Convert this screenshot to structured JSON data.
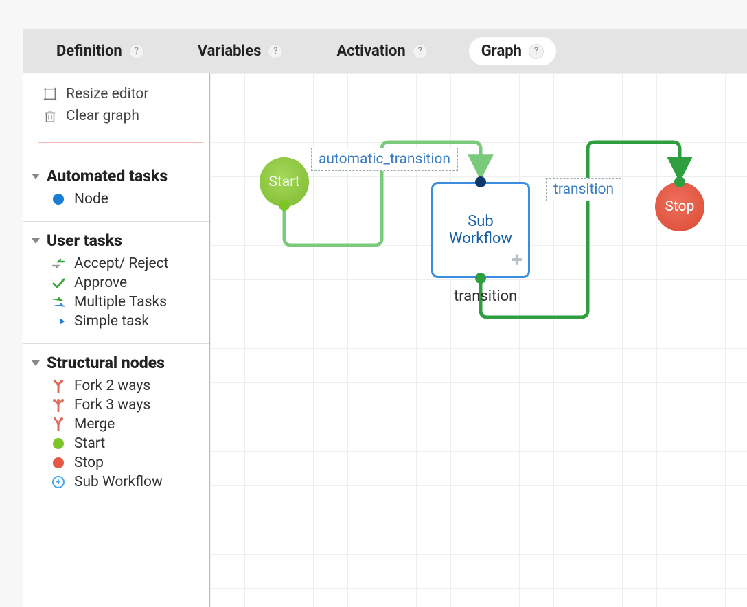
{
  "tabs": [
    {
      "label": "Definition",
      "active": false
    },
    {
      "label": "Variables",
      "active": false
    },
    {
      "label": "Activation",
      "active": false
    },
    {
      "label": "Graph",
      "active": true
    }
  ],
  "sidebar": {
    "actions": {
      "resize": "Resize editor",
      "clear": "Clear graph"
    },
    "groups": [
      {
        "title": "Automated tasks",
        "name": "automated-tasks",
        "items": [
          {
            "icon": "node",
            "label": "Node",
            "name": "node"
          }
        ]
      },
      {
        "title": "User tasks",
        "name": "user-tasks",
        "items": [
          {
            "icon": "accept-reject",
            "label": "Accept/ Reject",
            "name": "accept-reject"
          },
          {
            "icon": "approve",
            "label": "Approve",
            "name": "approve"
          },
          {
            "icon": "multiple",
            "label": "Multiple Tasks",
            "name": "multiple-tasks"
          },
          {
            "icon": "simple",
            "label": "Simple task",
            "name": "simple-task"
          }
        ]
      },
      {
        "title": "Structural nodes",
        "name": "structural-nodes",
        "items": [
          {
            "icon": "fork2",
            "label": "Fork 2 ways",
            "name": "fork-2-ways"
          },
          {
            "icon": "fork3",
            "label": "Fork 3 ways",
            "name": "fork-3-ways"
          },
          {
            "icon": "merge",
            "label": "Merge",
            "name": "merge"
          },
          {
            "icon": "start",
            "label": "Start",
            "name": "start"
          },
          {
            "icon": "stop",
            "label": "Stop",
            "name": "stop"
          },
          {
            "icon": "subwf",
            "label": "Sub Workflow",
            "name": "sub-workflow"
          }
        ]
      }
    ]
  },
  "graph": {
    "nodes": {
      "start": {
        "label": "Start"
      },
      "subwf": {
        "label": "Sub Workflow"
      },
      "stop": {
        "label": "Stop"
      }
    },
    "edges": {
      "e1": {
        "label": "automatic_transition"
      },
      "e2": {
        "label": "transition"
      },
      "e3": {
        "label": "transition"
      }
    }
  }
}
